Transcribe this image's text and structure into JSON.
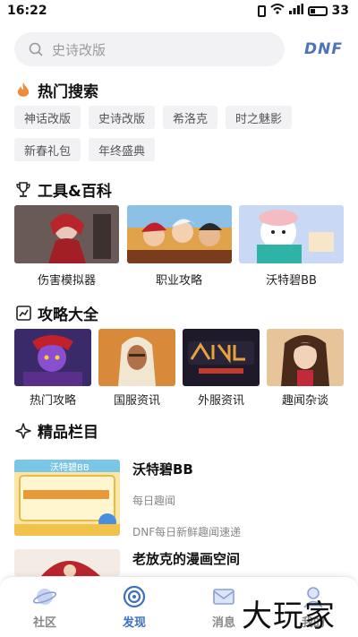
{
  "status": {
    "time": "16:22",
    "battery": "33"
  },
  "search": {
    "placeholder": "史诗改版",
    "logo": "DNF"
  },
  "hot": {
    "title": "热门搜索",
    "tags": [
      "神话改版",
      "史诗改版",
      "希洛克",
      "时之魅影",
      "新春礼包",
      "年终盛典"
    ]
  },
  "tools": {
    "title": "工具&百科",
    "items": [
      {
        "label": "伤害模拟器"
      },
      {
        "label": "职业攻略"
      },
      {
        "label": "沃特碧BB"
      }
    ]
  },
  "guides": {
    "title": "攻略大全",
    "items": [
      {
        "label": "热门攻略"
      },
      {
        "label": "国服资讯"
      },
      {
        "label": "外服资讯"
      },
      {
        "label": "趣闻杂谈"
      }
    ]
  },
  "columns": {
    "title": "精品栏目",
    "items": [
      {
        "title": "沃特碧BB",
        "subtitle": "每日趣闻",
        "desc": "DNF每日新鲜趣闻速递",
        "thumb_text": "沃特碧BB"
      },
      {
        "title": "老放克的漫画空间"
      }
    ]
  },
  "tabbar": {
    "items": [
      {
        "label": "社区",
        "active": false
      },
      {
        "label": "发现",
        "active": true
      },
      {
        "label": "消息",
        "active": false
      },
      {
        "label": "我的",
        "active": false
      }
    ]
  },
  "watermark": "大玩家",
  "colors": {
    "accent": "#3f6fc0",
    "logo": "#4e74b8",
    "tagBg": "#f2f2f4",
    "flame": "#f08a3c"
  }
}
